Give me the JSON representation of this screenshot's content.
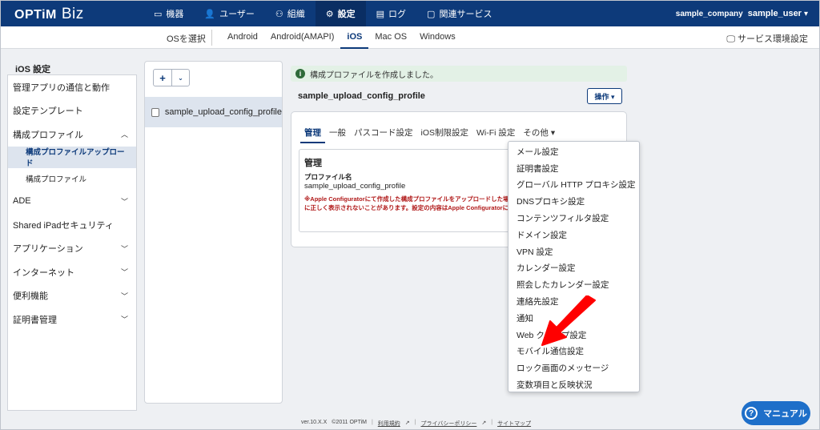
{
  "header": {
    "logo_main": "OPTiM",
    "logo_sub": "Biz",
    "nav": [
      {
        "icon": "device-icon",
        "glyph": "▭",
        "label": "機器"
      },
      {
        "icon": "user-icon",
        "glyph": "👤",
        "label": "ユーザー"
      },
      {
        "icon": "org-icon",
        "glyph": "⚇",
        "label": "組織"
      },
      {
        "icon": "gear-icon",
        "glyph": "⚙",
        "label": "設定"
      },
      {
        "icon": "log-icon",
        "glyph": "▤",
        "label": "ログ"
      },
      {
        "icon": "folder-icon",
        "glyph": "▢",
        "label": "関連サービス"
      }
    ],
    "company": "sample_company",
    "user": "sample_user"
  },
  "osbar": {
    "label": "OSを選択",
    "tabs": [
      "Android",
      "Android(AMAPI)",
      "iOS",
      "Mac OS",
      "Windows"
    ],
    "service_label": "サービス環境設定"
  },
  "sidebar": {
    "title": "iOS 設定",
    "items": [
      {
        "label": "管理アプリの通信と動作",
        "chev": ""
      },
      {
        "label": "設定テンプレート",
        "chev": ""
      },
      {
        "label": "構成プロファイル",
        "chev": "^"
      },
      {
        "label": "構成プロファイルアップロード",
        "chev": ""
      },
      {
        "label": "構成プロファイル",
        "chev": ""
      },
      {
        "label": "ADE",
        "chev": "v"
      },
      {
        "label": "Shared iPadセキュリティ",
        "chev": ""
      },
      {
        "label": "アプリケーション",
        "chev": "v"
      },
      {
        "label": "インターネット",
        "chev": "v"
      },
      {
        "label": "便利機能",
        "chev": "v"
      },
      {
        "label": "証明書管理",
        "chev": "v"
      }
    ]
  },
  "list": {
    "add": "+",
    "menu": "⌄",
    "row": "sample_upload_config_profile"
  },
  "main": {
    "toast": "構成プロファイルを作成しました。",
    "profile_name": "sample_upload_config_profile",
    "op_button": "操作 ▾",
    "tabs": [
      "管理",
      "一般",
      "パスコード設定",
      "iOS制限設定",
      "Wi-Fi 設定",
      "その他 ▾"
    ],
    "section_title": "管理",
    "field_label": "プロファイル名",
    "field_value": "sample_upload_config_profile",
    "warn1": "※Apple Configuratorにて作成した構成プロファイルをアップロードした場合",
    "warn2": "に正しく表示されないことがあります。設定の内容はApple Configuratorにて"
  },
  "dropdown": [
    "メール設定",
    "証明書設定",
    "グローバル HTTP プロキシ設定",
    "DNSプロキシ設定",
    "コンテンツフィルタ設定",
    "ドメイン設定",
    "VPN 設定",
    "カレンダー設定",
    "照会したカレンダー設定",
    "連絡先設定",
    "通知",
    "Web クリップ設定",
    "モバイル通信設定",
    "ロック画面のメッセージ",
    "変数項目と反映状況"
  ],
  "footer": {
    "version": "ver.10.X.X",
    "copyright": "©2011 OPTiM",
    "terms": "利用規約",
    "privacy": "プライバシーポリシー",
    "sitemap": "サイトマップ"
  },
  "manual": "マニュアル",
  "colors": {
    "primary": "#0d3a7a",
    "arrow": "#ff0000",
    "warn": "#b01818"
  }
}
